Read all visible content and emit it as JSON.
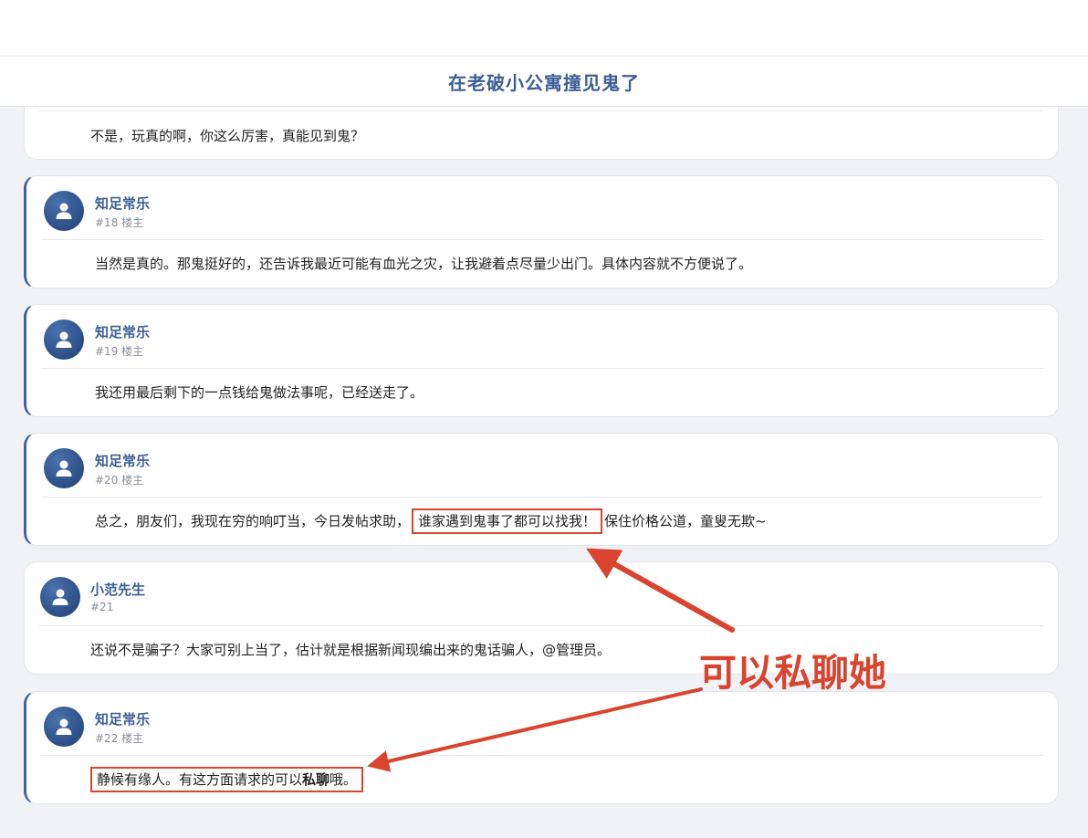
{
  "thread": {
    "title": "在老破小公寓撞见鬼了"
  },
  "posts": [
    {
      "content": "不是，玩真的啊，你这么厉害，真能见到鬼？"
    },
    {
      "author": "知足常乐",
      "floor": "#18 楼主",
      "content": "当然是真的。那鬼挺好的，还告诉我最近可能有血光之灾，让我避着点尽量少出门。具体内容就不方便说了。"
    },
    {
      "author": "知足常乐",
      "floor": "#19 楼主",
      "content": "我还用最后剩下的一点钱给鬼做法事呢，已经送走了。"
    },
    {
      "author": "知足常乐",
      "floor": "#20 楼主",
      "content_before": "总之，朋友们，我现在穷的响叮当，今日发帖求助，",
      "content_highlight": "谁家遇到鬼事了都可以找我！",
      "content_after": "保住价格公道，童叟无欺~"
    },
    {
      "author": "小范先生",
      "floor": "#21",
      "content": "还说不是骗子？大家可别上当了，估计就是根据新闻现编出来的鬼话骗人，@管理员。"
    },
    {
      "author": "知足常乐",
      "floor": "#22 楼主",
      "content_before": "静候有缘人。有这方面请求的可以",
      "content_bold": "私聊",
      "content_after": "哦。"
    }
  ],
  "annotation": {
    "callout": "可以私聊她",
    "color": "#d9442f"
  },
  "colors": {
    "accent": "#3d5f96",
    "background": "#f0f2f5"
  }
}
